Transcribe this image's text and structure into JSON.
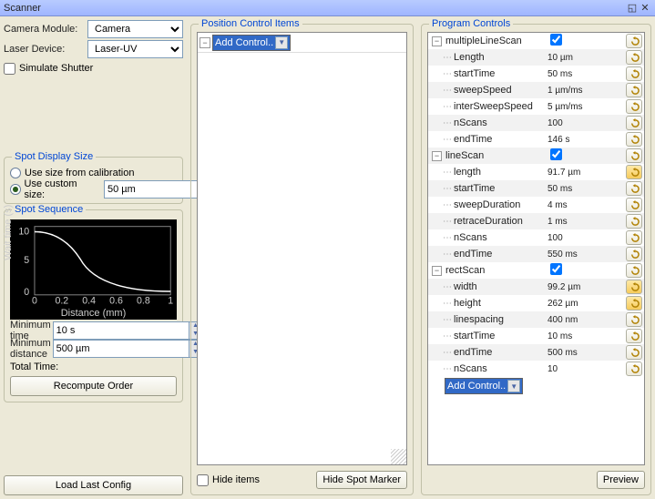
{
  "window": {
    "title": "Scanner"
  },
  "left": {
    "cameraModuleLabel": "Camera Module:",
    "cameraModuleValue": "Camera",
    "laserDeviceLabel": "Laser Device:",
    "laserDeviceValue": "Laser-UV",
    "simulateShutter": "Simulate Shutter",
    "spotDisplay": {
      "legend": "Spot Display Size",
      "calib": "Use size from calibration",
      "custom": "Use custom size:",
      "customValue": "50 µm"
    },
    "spotSeq": {
      "legend": "Spot Sequence",
      "ylabel": "Wait time (s)",
      "xlabel": "Distance (mm)",
      "yticks": [
        "10",
        "5",
        "0"
      ],
      "xticks": [
        "0",
        "0.2",
        "0.4",
        "0.6",
        "0.8",
        "1"
      ],
      "minTimeLabel": "Minimum time",
      "minTimeValue": "10 s",
      "minDistLabel": "Minimum distance",
      "minDistValue": "500 µm",
      "totalTime": "Total Time:",
      "recompute": "Recompute Order"
    },
    "loadConfig": "Load Last Config"
  },
  "mid": {
    "legend": "Position Control Items",
    "addControl": "Add Control..",
    "hideItems": "Hide items",
    "hideSpot": "Hide Spot Marker"
  },
  "right": {
    "legend": "Program Controls",
    "addControl": "Add Control..",
    "preview": "Preview",
    "tree": [
      {
        "t": "hdr",
        "name": "multipleLineScan",
        "chk": true,
        "alt": false
      },
      {
        "t": "leaf",
        "name": "Length",
        "val": "10 µm",
        "alt": true
      },
      {
        "t": "leaf",
        "name": "startTime",
        "val": "50 ms",
        "alt": false
      },
      {
        "t": "leaf",
        "name": "sweepSpeed",
        "val": "1 µm/ms",
        "alt": true
      },
      {
        "t": "leaf",
        "name": "interSweepSpeed",
        "val": "5 µm/ms",
        "alt": false
      },
      {
        "t": "leaf",
        "name": "nScans",
        "val": "100",
        "alt": true
      },
      {
        "t": "leaf",
        "name": "endTime",
        "val": "146 s",
        "alt": false
      },
      {
        "t": "hdr",
        "name": "lineScan",
        "chk": true,
        "alt": true
      },
      {
        "t": "leaf",
        "name": "length",
        "val": "91.7 µm",
        "alt": false,
        "hl": true
      },
      {
        "t": "leaf",
        "name": "startTime",
        "val": "50 ms",
        "alt": true
      },
      {
        "t": "leaf",
        "name": "sweepDuration",
        "val": "4 ms",
        "alt": false
      },
      {
        "t": "leaf",
        "name": "retraceDuration",
        "val": "1 ms",
        "alt": true
      },
      {
        "t": "leaf",
        "name": "nScans",
        "val": "100",
        "alt": false
      },
      {
        "t": "leaf",
        "name": "endTime",
        "val": "550 ms",
        "alt": true
      },
      {
        "t": "hdr",
        "name": "rectScan",
        "chk": true,
        "alt": false
      },
      {
        "t": "leaf",
        "name": "width",
        "val": "99.2 µm",
        "alt": true,
        "hl": true
      },
      {
        "t": "leaf",
        "name": "height",
        "val": "262 µm",
        "alt": false,
        "hl": true
      },
      {
        "t": "leaf",
        "name": "linespacing",
        "val": "400 nm",
        "alt": true
      },
      {
        "t": "leaf",
        "name": "startTime",
        "val": "10 ms",
        "alt": false
      },
      {
        "t": "leaf",
        "name": "endTime",
        "val": "500 ms",
        "alt": true
      },
      {
        "t": "leaf",
        "name": "nScans",
        "val": "10",
        "alt": false
      }
    ]
  }
}
